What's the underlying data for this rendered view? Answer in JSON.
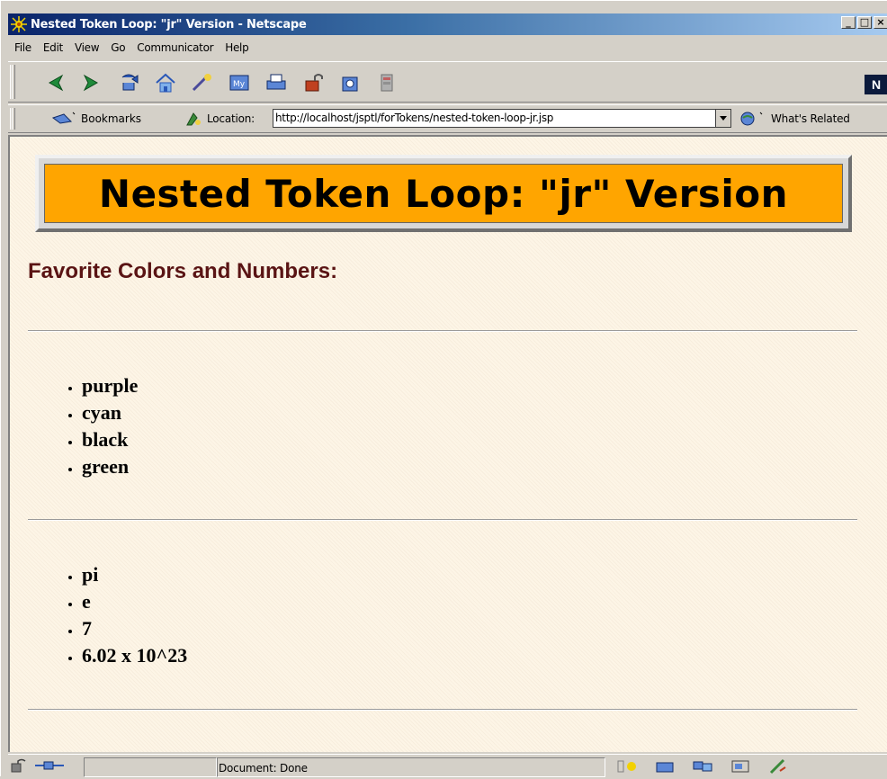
{
  "window": {
    "title": "Nested Token Loop: \"jr\" Version - Netscape",
    "controls": [
      "_",
      "□",
      "×"
    ]
  },
  "menu": [
    "File",
    "Edit",
    "View",
    "Go",
    "Communicator",
    "Help"
  ],
  "nav_toolbar": {
    "icons": [
      "back-icon",
      "forward-icon",
      "reload-icon",
      "home-icon",
      "search-icon",
      "my-netscape-icon",
      "print-icon",
      "security-icon",
      "shop-icon",
      "stop-icon"
    ],
    "logo_text": "N"
  },
  "location_toolbar": {
    "bookmarks_label": "Bookmarks",
    "location_label": "Location:",
    "url": "http://localhost/jsptl/forTokens/nested-token-loop-jr.jsp",
    "related_label": "What's Related"
  },
  "page": {
    "banner_title": "Nested Token Loop: \"jr\" Version",
    "subheading": "Favorite Colors and Numbers:",
    "colors": [
      "purple",
      "cyan",
      "black",
      "green"
    ],
    "numbers": [
      "pi",
      "e",
      "7",
      "6.02 x 10^23"
    ]
  },
  "status": {
    "text": "Document: Done"
  },
  "colors": {
    "banner_bg": "#ffa500",
    "page_bg": "#fdf5e6",
    "subheading": "#5a1414"
  }
}
